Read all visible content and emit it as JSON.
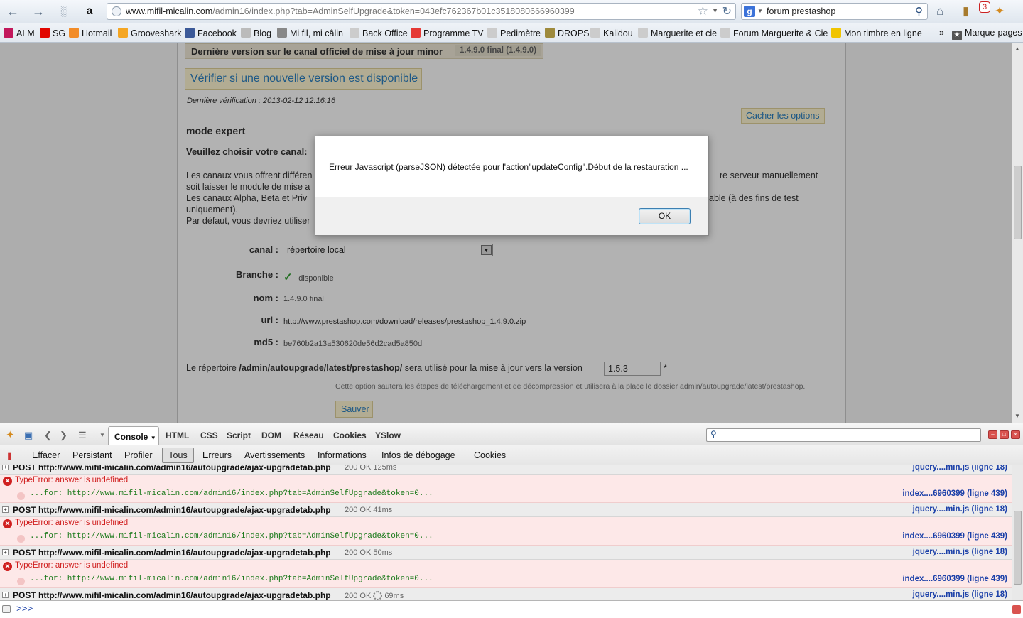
{
  "browser": {
    "url_host": "www.mifil-micalin.com",
    "url_path": "/admin16/index.php?tab=AdminSelfUpgrade&token=043efc762367b01c3518080666960399",
    "search_query": "forum prestashop",
    "notification_count": "3"
  },
  "bookmarks": [
    {
      "label": "ALM",
      "color": "#c2185b"
    },
    {
      "label": "SG",
      "color": "#e10600"
    },
    {
      "label": "Hotmail",
      "color": "#f28c28"
    },
    {
      "label": "Grooveshark",
      "color": "#f5a623"
    },
    {
      "label": "Facebook",
      "color": "#3b5998"
    },
    {
      "label": "Blog",
      "color": "#bbbbbb"
    },
    {
      "label": "Mi fil, mi câlin",
      "color": "#888888"
    },
    {
      "label": "Back Office",
      "color": "#cccccc"
    },
    {
      "label": "Programme TV",
      "color": "#e53935"
    },
    {
      "label": "Pedimètre",
      "color": "#cccccc"
    },
    {
      "label": "DROPS",
      "color": "#9e8a3c"
    },
    {
      "label": "Kalidou",
      "color": "#cccccc"
    },
    {
      "label": "Marguerite et cie",
      "color": "#cccccc"
    },
    {
      "label": "Forum Marguerite & Cie",
      "color": "#cccccc"
    },
    {
      "label": "Mon timbre en ligne",
      "color": "#f0c400"
    }
  ],
  "bookmarks_more": "»",
  "bookmarks_menu": "Marque-pages",
  "page": {
    "latest_label": "Dernière version sur le canal officiel de mise à jour minor",
    "latest_value": "1.4.9.0 final (1.4.9.0)",
    "check_button": "Vérifier si une nouvelle version est disponible",
    "last_check": "Dernière vérification : 2013-02-12 12:16:16",
    "hide_options": "Cacher les options",
    "mode_title": "mode expert",
    "choose_channel": "Veuillez choisir votre canal:",
    "desc_line1": "Les canaux vous offrent différen",
    "desc_line1_right": "re serveur manuellement",
    "desc_line2": "soit laisser le module de mise a",
    "desc_line3": "Les canaux Alpha, Beta et Priv",
    "desc_line3_right": "able (à des fins de test",
    "desc_line4": "uniquement).",
    "desc_line5": "Par défaut, vous devriez utiliser",
    "canal_label": "canal :",
    "canal_value": "répertoire local",
    "branche_label": "Branche :",
    "branche_value": "disponible",
    "nom_label": "nom :",
    "nom_value": "1.4.9.0 final",
    "url_label": "url :",
    "url_value": "http://www.prestashop.com/download/releases/prestashop_1.4.9.0.zip",
    "md5_label": "md5 :",
    "md5_value": "be760b2a13a530620de56d2cad5a850d",
    "dir_prefix": "Le répertoire",
    "dir_path": "/admin/autoupgrade/latest/prestashop/",
    "dir_suffix": "sera utilisé pour la mise à jour vers la version",
    "version_value": "1.5.3",
    "asterisk": "*",
    "dir_note": "Cette option sautera les étapes de téléchargement et de décompression et utilisera à la place le dossier admin/autoupgrade/latest/prestashop.",
    "save_button": "Sauver"
  },
  "dialog": {
    "message": "Erreur Javascript (parseJSON) détectée pour l'action\"updateConfig\".Début de la restauration ...",
    "ok": "OK"
  },
  "firebug": {
    "console_tab": "Console",
    "tabs": [
      "HTML",
      "CSS",
      "Script",
      "DOM",
      "Réseau",
      "Cookies",
      "YSlow"
    ],
    "sub": [
      "Effacer",
      "Persistant",
      "Profiler",
      "Tous",
      "Erreurs",
      "Avertissements",
      "Informations",
      "Infos de débogage",
      "Cookies"
    ],
    "log": [
      {
        "kind": "post",
        "req": "POST http://www.mifil-micalin.com/admin16/autoupgrade/ajax-upgradetab.php",
        "status": "200 OK 125ms",
        "src": "jquery....min.js (ligne 18)"
      },
      {
        "kind": "err",
        "msg": "TypeError: answer is undefined",
        "trace": "...for: http://www.mifil-micalin.com/admin16/index.php?tab=AdminSelfUpgrade&token=0...",
        "src": "index....6960399 (ligne 439)"
      },
      {
        "kind": "post",
        "req": "POST http://www.mifil-micalin.com/admin16/autoupgrade/ajax-upgradetab.php",
        "status": "200 OK 41ms",
        "src": "jquery....min.js (ligne 18)"
      },
      {
        "kind": "err",
        "msg": "TypeError: answer is undefined",
        "trace": "...for: http://www.mifil-micalin.com/admin16/index.php?tab=AdminSelfUpgrade&token=0...",
        "src": "index....6960399 (ligne 439)"
      },
      {
        "kind": "post",
        "req": "POST http://www.mifil-micalin.com/admin16/autoupgrade/ajax-upgradetab.php",
        "status": "200 OK 50ms",
        "src": "jquery....min.js (ligne 18)"
      },
      {
        "kind": "err",
        "msg": "TypeError: answer is undefined",
        "trace": "...for: http://www.mifil-micalin.com/admin16/index.php?tab=AdminSelfUpgrade&token=0...",
        "src": "index....6960399 (ligne 439)"
      },
      {
        "kind": "post",
        "req": "POST http://www.mifil-micalin.com/admin16/autoupgrade/ajax-upgradetab.php",
        "status": "200 OK",
        "status_time": "69ms",
        "src": "jquery....min.js (ligne 18)"
      }
    ],
    "prompt": ">>>"
  }
}
